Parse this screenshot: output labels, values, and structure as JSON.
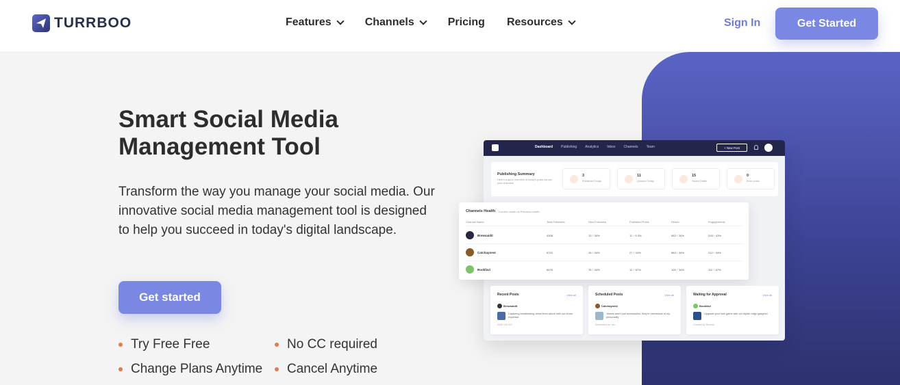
{
  "brand": {
    "name": "TURRBOO"
  },
  "nav": {
    "items": [
      {
        "label": "Features",
        "dropdown": true
      },
      {
        "label": "Channels",
        "dropdown": true
      },
      {
        "label": "Pricing",
        "dropdown": false
      },
      {
        "label": "Resources",
        "dropdown": true
      }
    ],
    "sign_in": "Sign In",
    "get_started": "Get Started"
  },
  "hero": {
    "title_line1": "Smart Social Media",
    "title_line2": "Management Tool",
    "description": "Transform the way you manage your social media. Our innovative social media management tool is designed to help you succeed in today's digital landscape.",
    "cta": "Get started",
    "features": [
      "Try Free Free",
      "No CC required",
      "Change Plans Anytime",
      "Cancel Anytime"
    ]
  },
  "colors": {
    "accent": "#7a87e3",
    "panel_top": "#5a64c4",
    "panel_bottom": "#2d316e",
    "bullet": "#e27a4c",
    "dash_header": "#23264a"
  },
  "dashboard": {
    "nav": [
      "Dashboard",
      "Publishing",
      "Analytics",
      "Inbox",
      "Channels",
      "Team"
    ],
    "new_post": "+ New Post",
    "summary": {
      "title": "Publishing Summary",
      "subtitle": "Here's a quick overview of today's posts across your channels",
      "stats": [
        {
          "num": "3",
          "label": "Published Today"
        },
        {
          "num": "11",
          "label": "Queued Today"
        },
        {
          "num": "15",
          "label": "Saved Drafts"
        },
        {
          "num": "0",
          "label": "Error posts"
        }
      ]
    },
    "health": {
      "title": "Channels Health",
      "subtitle": "Current month vs Previous month",
      "headers": [
        "Channel Name",
        "Total Followers",
        "New Followers",
        "Published Posts",
        "Reach",
        "Engagements"
      ],
      "rows": [
        {
          "name": "Brewsaidit",
          "cells": [
            "4308",
            "13 ↑ 34%",
            "11 ↑ 9.3%",
            "083 ↑ 34%",
            "318 ↑ 43%"
          ]
        },
        {
          "name": "Catchaynest",
          "cells": [
            "5723",
            "15 ↑ 34%",
            "27 ↑ 24%",
            "583 ↑ 34%",
            "212 ↑ 34%"
          ]
        },
        {
          "name": "Bookfavi",
          "cells": [
            "8476",
            "78 ↑ 34%",
            "12 ↑ 67%",
            "109 ↑ 34%",
            "112 ↑ 67%"
          ]
        }
      ]
    },
    "cards": [
      {
        "title": "Recent Posts",
        "link": "View all",
        "user": "Brewsaidit",
        "text": "Capturing breathtaking views from above with our drone expertise",
        "meta": "4936  120  247"
      },
      {
        "title": "Scheduled Posts",
        "link": "View all",
        "user": "Catchaynest",
        "text": "Jewels aren't just accessories, they're extensions of my personality",
        "meta": "Scheduled for You"
      },
      {
        "title": "Waiting for Approval",
        "link": "View all",
        "user": "Bookfavi",
        "text": "Upgrade your look game with our stylish edge gadgets!",
        "meta": "Created by Richard"
      }
    ]
  }
}
